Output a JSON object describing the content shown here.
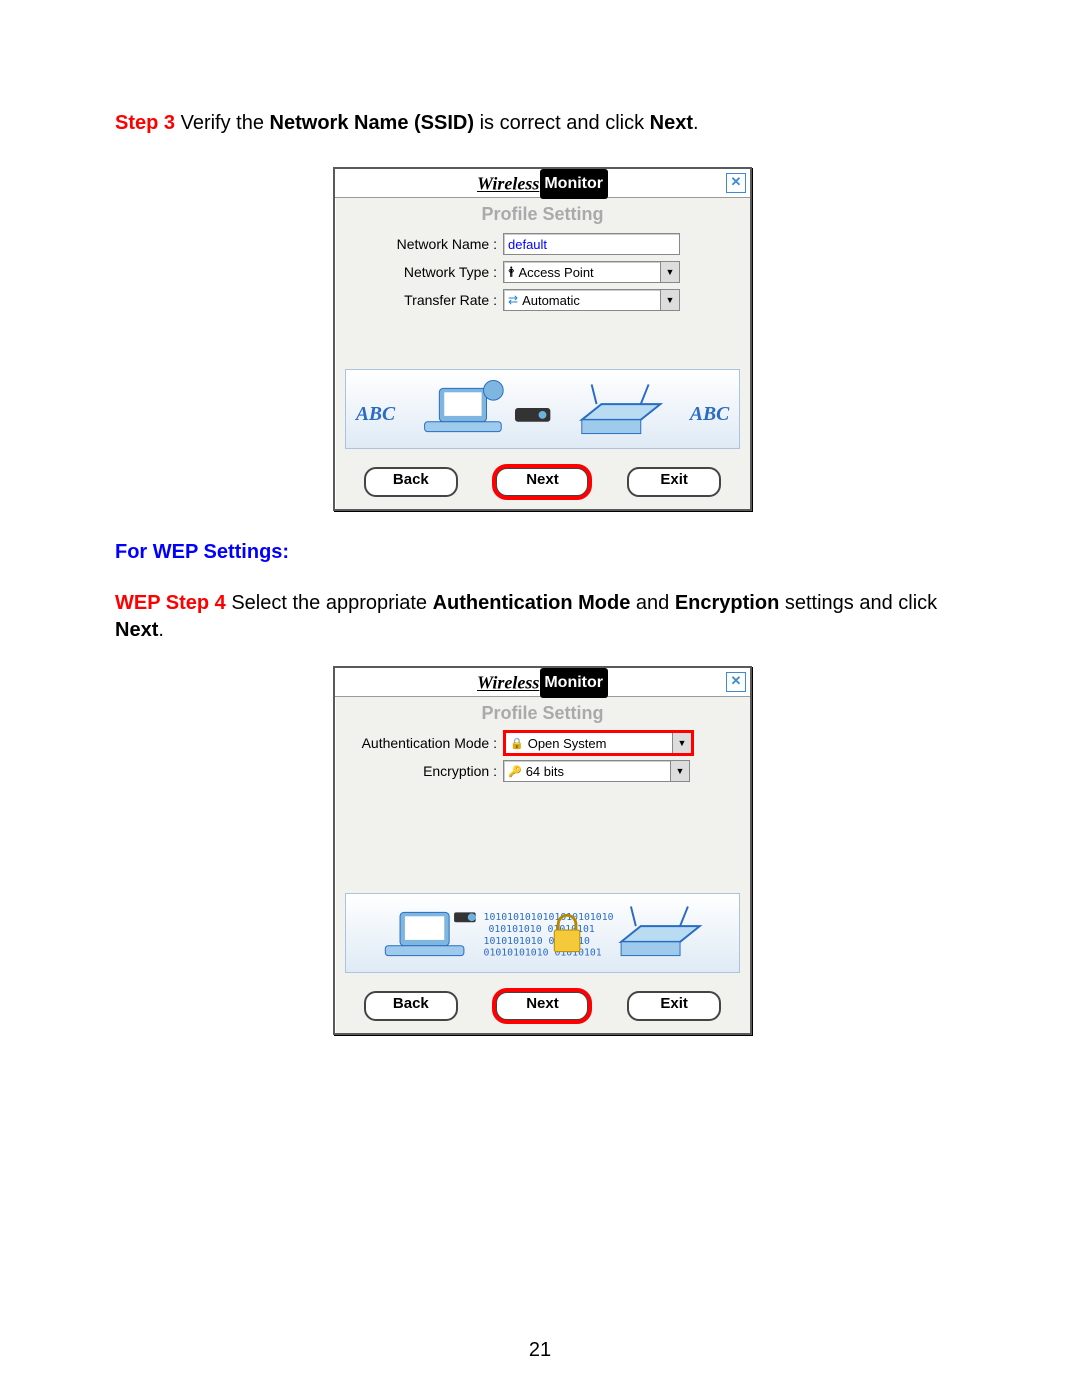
{
  "step3": {
    "prefix": "Step 3",
    "t1": " Verify the ",
    "b1": "Network Name (SSID)",
    "t2": " is correct and click ",
    "b2": "Next",
    "t3": "."
  },
  "dialog1": {
    "title_italic": "Wireless",
    "title_box": "Monitor",
    "close": "✕",
    "subtitle": "Profile Setting",
    "network_name_label": "Network Name :",
    "network_name_value": "default",
    "network_type_label": "Network Type :",
    "network_type_value": "Access Point",
    "transfer_rate_label": "Transfer Rate :",
    "transfer_rate_value": "Automatic",
    "abc": "ABC",
    "back": "Back",
    "next": "Next",
    "exit": "Exit"
  },
  "wep_heading": "For WEP Settings:",
  "step4": {
    "prefix": "WEP Step 4",
    "t1": " Select the appropriate ",
    "b1": "Authentication Mode",
    "t2": " and ",
    "b2": "Encryption",
    "t3": " settings and click ",
    "b3": "Next",
    "t4": "."
  },
  "dialog2": {
    "title_italic": "Wireless",
    "title_box": "Monitor",
    "close": "✕",
    "subtitle": "Profile Setting",
    "auth_mode_label": "Authentication Mode :",
    "auth_mode_value": "Open System",
    "encryption_label": "Encryption :",
    "encryption_value": "64 bits",
    "back": "Back",
    "next": "Next",
    "exit": "Exit"
  },
  "page_number": "21"
}
